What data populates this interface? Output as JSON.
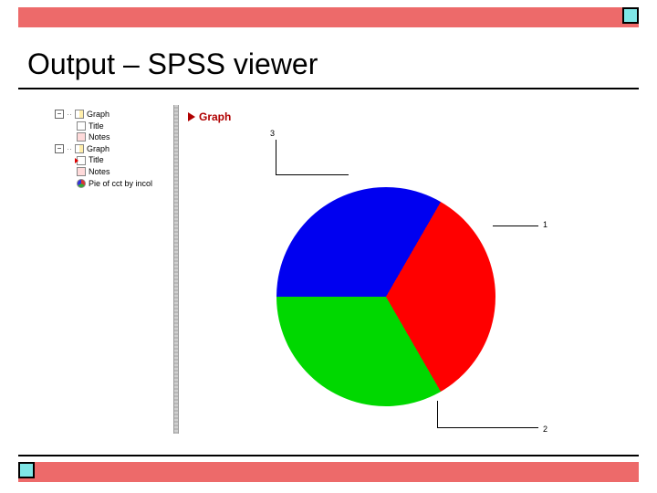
{
  "slide": {
    "title": "Output – SPSS viewer"
  },
  "outline": {
    "items": [
      {
        "label": "Graph",
        "key": "g1"
      },
      {
        "label": "Title",
        "key": "g1t"
      },
      {
        "label": "Notes",
        "key": "g1n"
      },
      {
        "label": "Graph",
        "key": "g2"
      },
      {
        "label": "Title",
        "key": "g2t"
      },
      {
        "label": "Notes",
        "key": "g2n"
      },
      {
        "label": "Pie of cct by incol",
        "key": "g2p"
      }
    ]
  },
  "content": {
    "heading": "Graph"
  },
  "chart_data": {
    "type": "pie",
    "title": "",
    "series": [
      {
        "name": "1",
        "value": 33.3,
        "color": "#ff0000"
      },
      {
        "name": "2",
        "value": 33.3,
        "color": "#00d800"
      },
      {
        "name": "3",
        "value": 33.3,
        "color": "#0000f0"
      }
    ],
    "labels": [
      "1",
      "2",
      "3"
    ]
  }
}
